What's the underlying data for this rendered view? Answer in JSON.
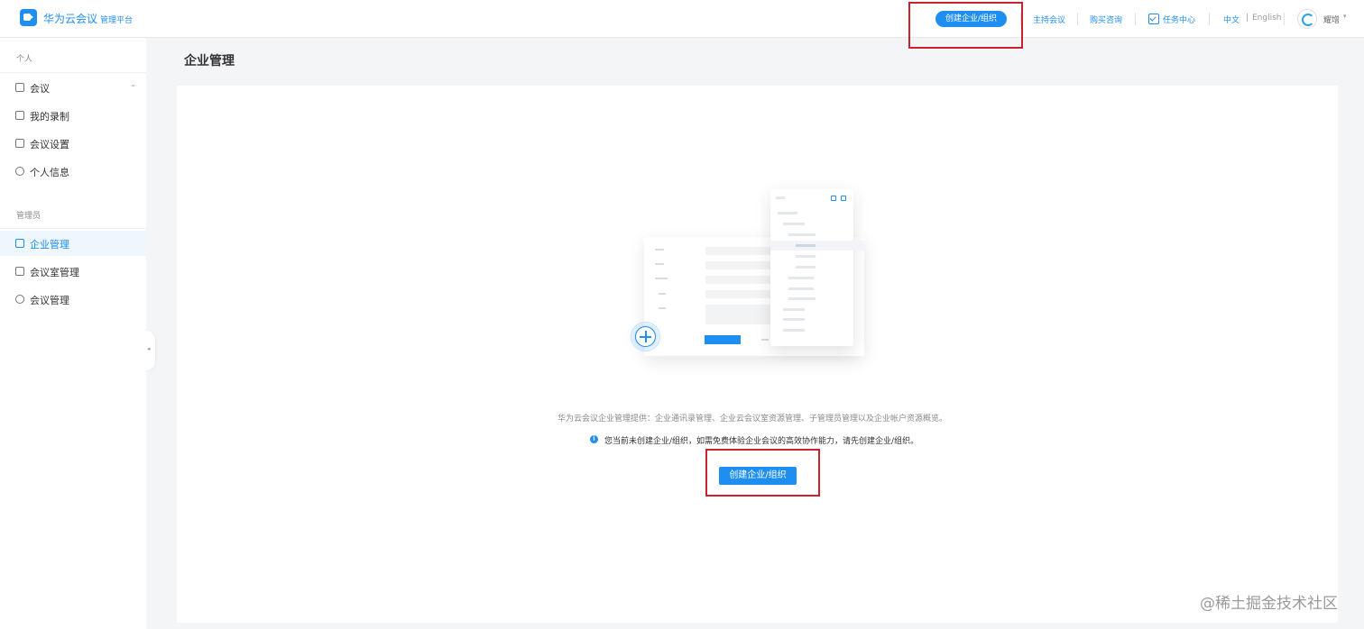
{
  "header": {
    "brand": "华为云会议",
    "brand_sub": "管理平台",
    "create_org_button": "创建企业/组织",
    "links": {
      "host_meeting": "主持会议",
      "purchase": "购买咨询",
      "task_center": "任务中心"
    },
    "language": {
      "current": "中文",
      "separator": "|",
      "alternate": "English"
    },
    "user_name": "耀增",
    "caret": "▾"
  },
  "sidebar": {
    "section_personal": "个人",
    "section_admin": "管理员",
    "items": [
      {
        "label": "会议",
        "icon": "calendar-icon",
        "caret": "⌄"
      },
      {
        "label": "我的录制",
        "icon": "recording-icon"
      },
      {
        "label": "会议设置",
        "icon": "settings-icon"
      },
      {
        "label": "个人信息",
        "icon": "user-icon"
      },
      {
        "label": "企业管理",
        "icon": "enterprise-icon",
        "active": true
      },
      {
        "label": "会议室管理",
        "icon": "room-icon"
      },
      {
        "label": "会议管理",
        "icon": "globe-icon"
      }
    ],
    "collapse_glyph": "◂"
  },
  "main": {
    "page_title": "企业管理",
    "description": "华为云会议企业管理提供：企业通讯录管理、企业云会议室资源管理、子管理员管理以及企业帐户资源概览。",
    "info_text": "您当前未创建企业/组织，如需免费体验企业会议的高效协作能力，请先创建企业/组织。",
    "create_button": "创建企业/组织",
    "info_glyph": "i"
  },
  "watermark": "@稀土掘金技术社区",
  "colors": {
    "accent": "#1f8ef1",
    "highlight_box": "#c8232c"
  }
}
